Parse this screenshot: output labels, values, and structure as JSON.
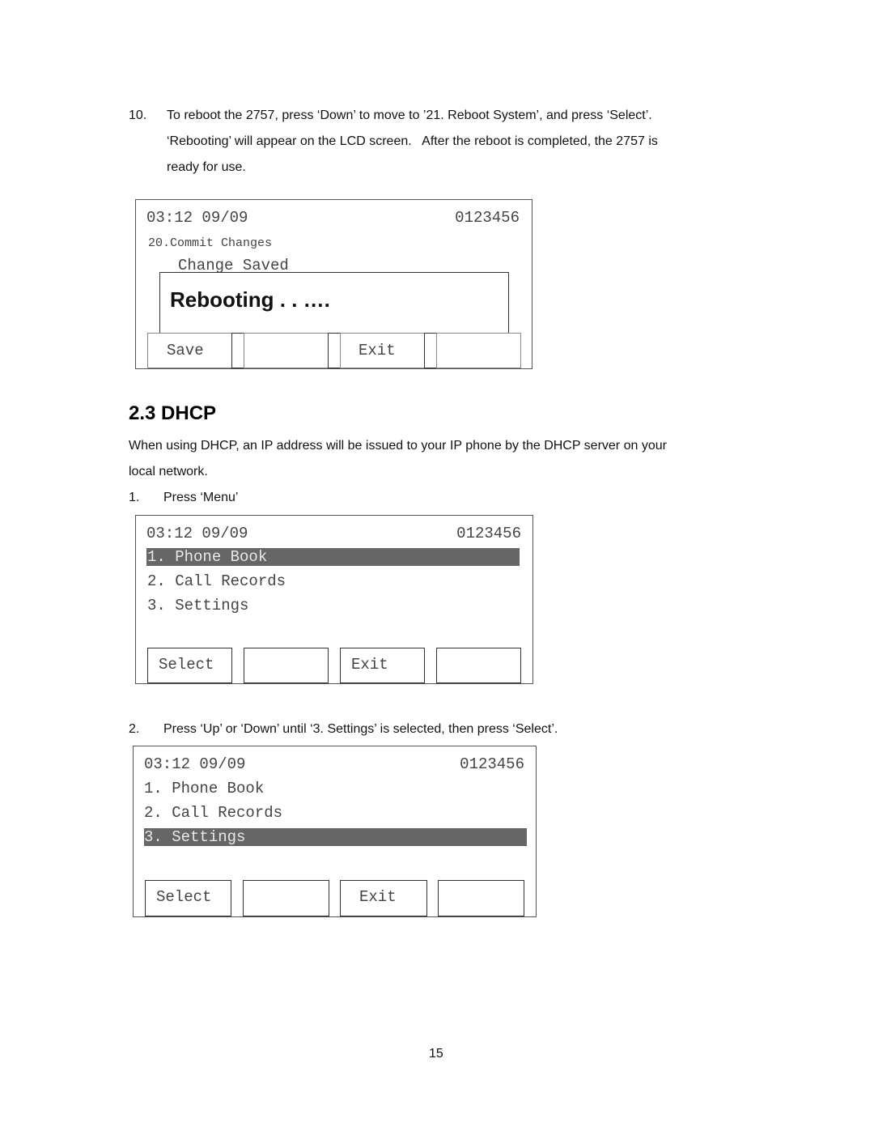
{
  "step10": {
    "number": "10.",
    "lines": [
      "To reboot the 2757, press ‘Down’ to move to ’21. Reboot System’, and press ‘Select’.",
      "‘Rebooting’ will appear on the LCD screen.   After the reboot is completed, the 2757 is",
      "ready for use."
    ]
  },
  "lcd_reboot": {
    "time_date": "03:12 09/09",
    "number": "0123456",
    "menu_item": "20.Commit Changes",
    "status": "Change Saved",
    "popup": "Rebooting . . ….",
    "softkeys": [
      "Save",
      "",
      "Exit",
      ""
    ]
  },
  "section": {
    "heading": "2.3 DHCP",
    "intro_lines": [
      "When using DHCP, an IP address will be issued to your IP phone by the DHCP server on your",
      "local network."
    ]
  },
  "step1": {
    "number": "1.",
    "text": "Press ‘Menu’"
  },
  "lcd_menu_1": {
    "time_date": "03:12 09/09",
    "number": "0123456",
    "items": [
      "1. Phone Book",
      "2. Call Records",
      "3. Settings"
    ],
    "selected_index": 0,
    "softkeys": [
      "Select",
      "",
      "Exit",
      ""
    ]
  },
  "step2": {
    "number": "2.",
    "text": "Press ‘Up’ or ‘Down’ until ‘3. Settings’ is selected, then press ‘Select’."
  },
  "lcd_menu_2": {
    "time_date": "03:12 09/09",
    "number": "0123456",
    "items": [
      "1. Phone Book",
      "2. Call Records",
      "3. Settings"
    ],
    "selected_index": 2,
    "softkeys": [
      "Select",
      "",
      "Exit",
      ""
    ]
  },
  "footer": {
    "page_number": "15"
  }
}
